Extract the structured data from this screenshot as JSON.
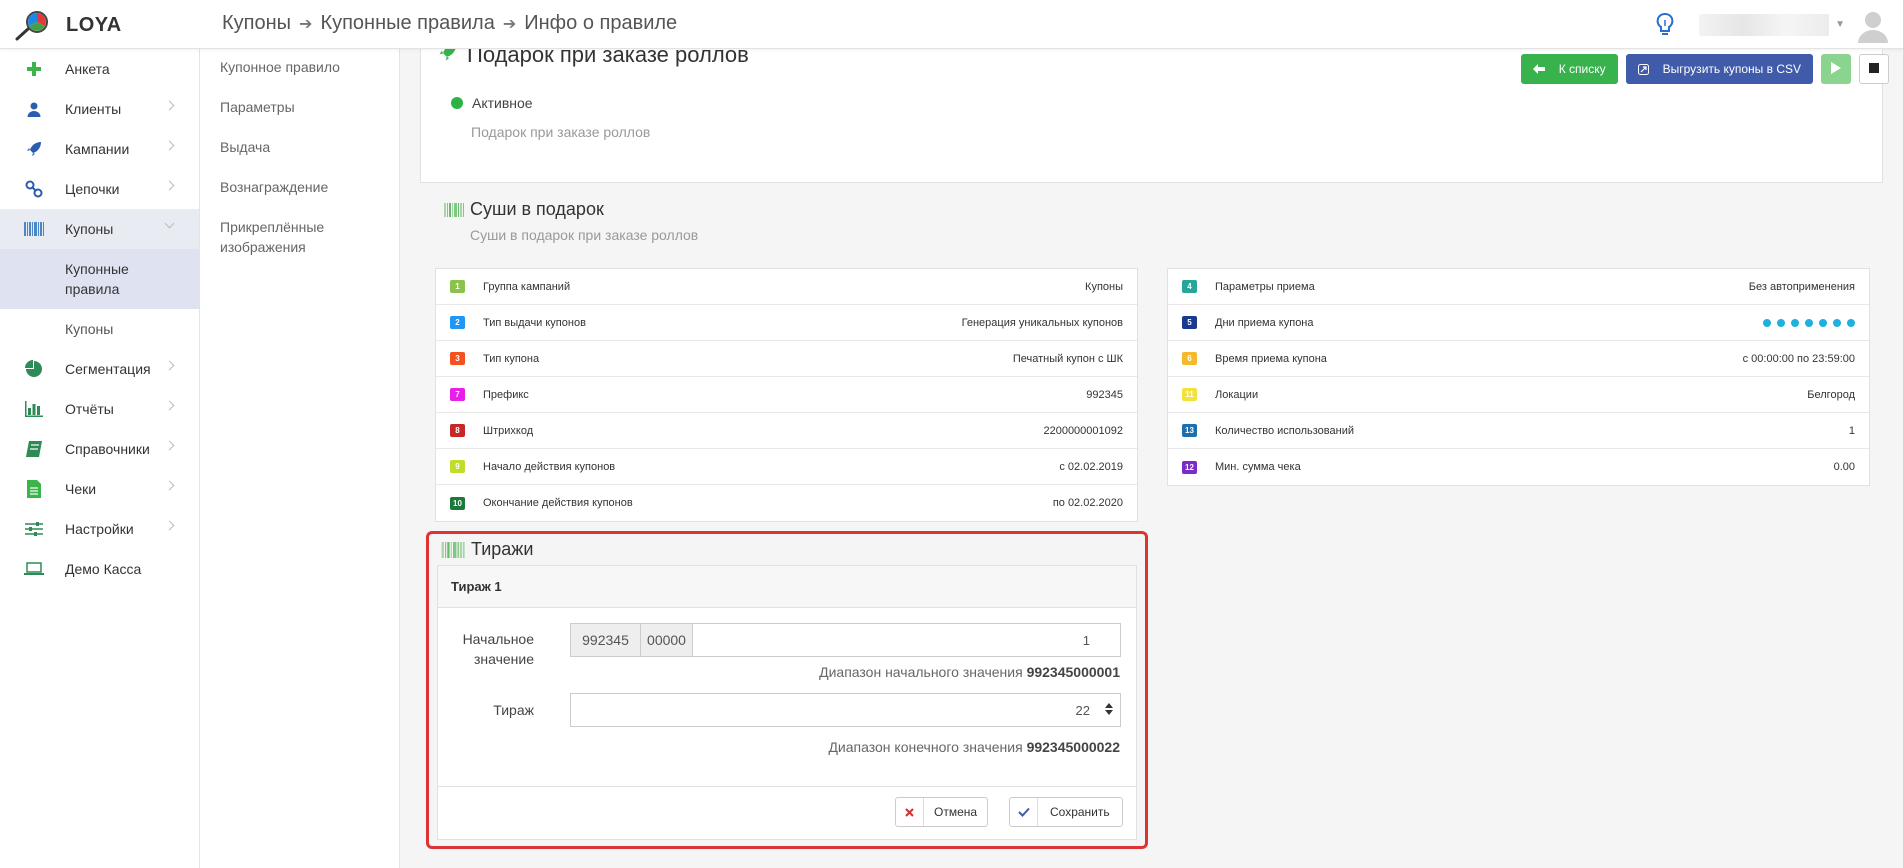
{
  "app": {
    "logo_text": "LOYA"
  },
  "breadcrumb": {
    "items": [
      "Купоны",
      "Купонные правила",
      "Инфо о правиле"
    ]
  },
  "sidebar": {
    "items": [
      {
        "label": "Анкета",
        "icon": "plus-icon",
        "chevron": false
      },
      {
        "label": "Клиенты",
        "icon": "user-icon",
        "chevron": true
      },
      {
        "label": "Кампании",
        "icon": "rocket-icon",
        "chevron": true
      },
      {
        "label": "Цепочки",
        "icon": "chain-icon",
        "chevron": true
      },
      {
        "label": "Купоны",
        "icon": "barcode-icon",
        "chevron": true,
        "active": true
      },
      {
        "label": "Сегментация",
        "icon": "pie-icon",
        "chevron": true
      },
      {
        "label": "Отчёты",
        "icon": "bar-chart-icon",
        "chevron": true
      },
      {
        "label": "Справочники",
        "icon": "book-icon",
        "chevron": true
      },
      {
        "label": "Чеки",
        "icon": "receipt-icon",
        "chevron": true
      },
      {
        "label": "Настройки",
        "icon": "sliders-icon",
        "chevron": true
      },
      {
        "label": "Демо Касса",
        "icon": "laptop-icon",
        "chevron": false
      }
    ],
    "sub_items": [
      "Купонные правила",
      "Купоны"
    ]
  },
  "subnav": {
    "items": [
      "Купонное правило",
      "Параметры",
      "Выдача",
      "Вознаграждение",
      "Прикреплённые изображения"
    ]
  },
  "actions": {
    "back_label": "К списку",
    "export_label": "Выгрузить купоны в CSV"
  },
  "rule": {
    "title": "Подарок при заказе роллов",
    "status": "Активное",
    "description": "Подарок при заказе роллов"
  },
  "coupon": {
    "title": "Суши в подарок",
    "subtitle": "Суши в подарок при заказе роллов"
  },
  "left_table": [
    {
      "num": "1",
      "color": "#8bc34a",
      "label": "Группа кампаний",
      "value": "Купоны"
    },
    {
      "num": "2",
      "color": "#2196f3",
      "label": "Тип выдачи купонов",
      "value": "Генерация уникальных купонов"
    },
    {
      "num": "3",
      "color": "#f4511e",
      "label": "Тип купона",
      "value": "Печатный купон с ШК"
    },
    {
      "num": "7",
      "color": "#e91ee9",
      "label": "Префикс",
      "value": "992345"
    },
    {
      "num": "8",
      "color": "#c62828",
      "label": "Штрихкод",
      "value": "2200000001092"
    },
    {
      "num": "9",
      "color": "#c0dd2c",
      "label": "Начало действия купонов",
      "value": "с 02.02.2019"
    },
    {
      "num": "10",
      "color": "#1b7a3a",
      "label": "Окончание действия купонов",
      "value": "по 02.02.2020"
    }
  ],
  "right_table": [
    {
      "num": "4",
      "color": "#26a69a",
      "label": "Параметры приема",
      "value": "Без автоприменения"
    },
    {
      "num": "5",
      "color": "#1a3a8f",
      "label": "Дни приема купона",
      "value": "",
      "dots": 7
    },
    {
      "num": "6",
      "color": "#f5b92b",
      "label": "Время приема купона",
      "value": "с 00:00:00 по 23:59:00"
    },
    {
      "num": "11",
      "color": "#f2e33b",
      "label": "Локации",
      "value": "Белгород"
    },
    {
      "num": "13",
      "color": "#1e6fae",
      "label": "Количество использований",
      "value": "1"
    },
    {
      "num": "12",
      "color": "#7b2bc9",
      "label": "Мин. сумма чека",
      "value": "0.00"
    }
  ],
  "tirazhi": {
    "title": "Тиражи",
    "panel_title": "Тираж 1",
    "start_label": "Начальное значение",
    "prefix": "992345",
    "zeros": "00000",
    "start_value": "1",
    "start_hint_text": "Диапазон начального значения",
    "start_hint_value": "992345000001",
    "count_label": "Тираж",
    "count_value": "22",
    "end_hint_text": "Диапазон конечного значения",
    "end_hint_value": "992345000022",
    "cancel_label": "Отмена",
    "save_label": "Сохранить"
  },
  "colors": {
    "accent_green": "#37b24d",
    "accent_blue": "#3f5ba9",
    "highlight_red": "#dd3333",
    "status_green": "#2db344",
    "dots_blue": "#1fb0e0"
  }
}
